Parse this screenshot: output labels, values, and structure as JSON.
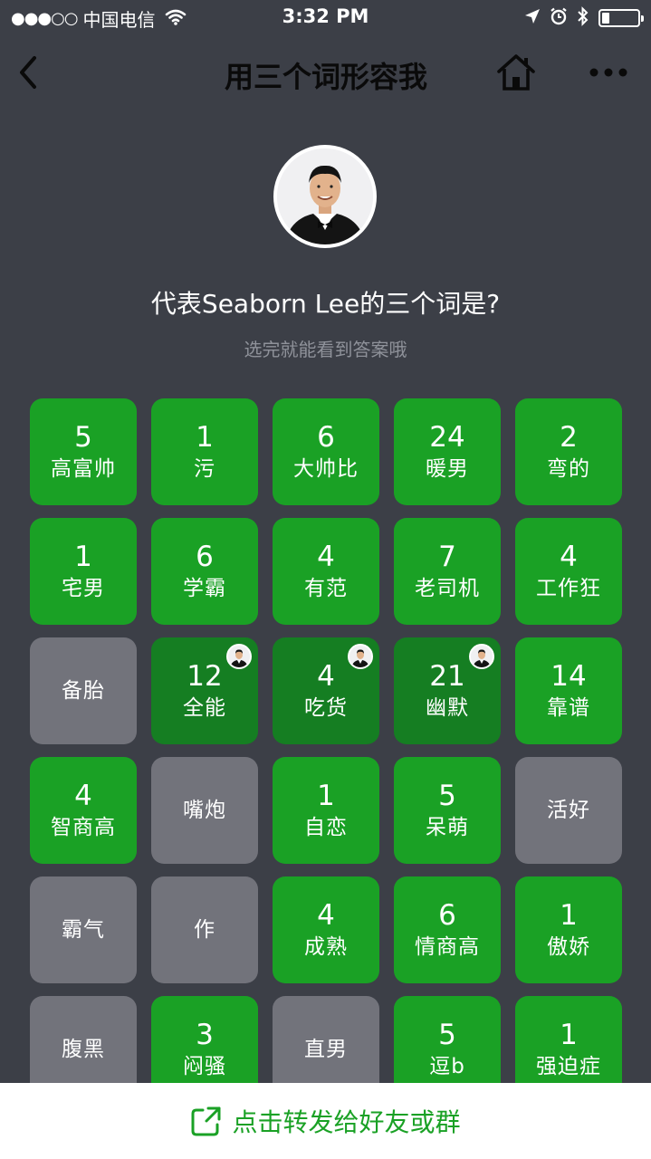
{
  "status_bar": {
    "signal": "●●●○○",
    "carrier": "中国电信",
    "time": "3:32 PM",
    "icons": [
      "wifi-icon",
      "location-arrow-icon",
      "alarm-icon",
      "bluetooth-icon",
      "battery-icon"
    ],
    "battery_level": 0.2
  },
  "nav": {
    "title": "用三个词形容我",
    "icons": [
      "back-chevron-icon",
      "home-icon",
      "more-dots-icon"
    ]
  },
  "profile": {
    "question": "代表Seaborn Lee的三个词是?",
    "hint": "选完就能看到答案哦"
  },
  "tiles": [
    {
      "count": "5",
      "label": "高富帅",
      "state": "green"
    },
    {
      "count": "1",
      "label": "污",
      "state": "green"
    },
    {
      "count": "6",
      "label": "大帅比",
      "state": "green"
    },
    {
      "count": "24",
      "label": "暖男",
      "state": "green"
    },
    {
      "count": "2",
      "label": "弯的",
      "state": "green"
    },
    {
      "count": "1",
      "label": "宅男",
      "state": "green"
    },
    {
      "count": "6",
      "label": "学霸",
      "state": "green"
    },
    {
      "count": "4",
      "label": "有范",
      "state": "green"
    },
    {
      "count": "7",
      "label": "老司机",
      "state": "green"
    },
    {
      "count": "4",
      "label": "工作狂",
      "state": "green"
    },
    {
      "count": "",
      "label": "备胎",
      "state": "gray"
    },
    {
      "count": "12",
      "label": "全能",
      "state": "selected"
    },
    {
      "count": "4",
      "label": "吃货",
      "state": "selected"
    },
    {
      "count": "21",
      "label": "幽默",
      "state": "selected"
    },
    {
      "count": "14",
      "label": "靠谱",
      "state": "green"
    },
    {
      "count": "4",
      "label": "智商高",
      "state": "green"
    },
    {
      "count": "",
      "label": "嘴炮",
      "state": "gray"
    },
    {
      "count": "1",
      "label": "自恋",
      "state": "green"
    },
    {
      "count": "5",
      "label": "呆萌",
      "state": "green"
    },
    {
      "count": "",
      "label": "活好",
      "state": "gray"
    },
    {
      "count": "",
      "label": "霸气",
      "state": "gray"
    },
    {
      "count": "",
      "label": "作",
      "state": "gray"
    },
    {
      "count": "4",
      "label": "成熟",
      "state": "green"
    },
    {
      "count": "6",
      "label": "情商高",
      "state": "green"
    },
    {
      "count": "1",
      "label": "傲娇",
      "state": "green"
    },
    {
      "count": "",
      "label": "腹黑",
      "state": "gray"
    },
    {
      "count": "3",
      "label": "闷骚",
      "state": "green"
    },
    {
      "count": "",
      "label": "直男",
      "state": "gray"
    },
    {
      "count": "5",
      "label": "逗b",
      "state": "green"
    },
    {
      "count": "1",
      "label": "强迫症",
      "state": "green"
    }
  ],
  "share": {
    "label": "点击转发给好友或群",
    "icon": "share-icon"
  },
  "colors": {
    "background": "#3c3f47",
    "tile_green": "#1aa125",
    "tile_selected": "#157e22",
    "tile_gray": "#72737b",
    "share_text": "#1aa125"
  }
}
